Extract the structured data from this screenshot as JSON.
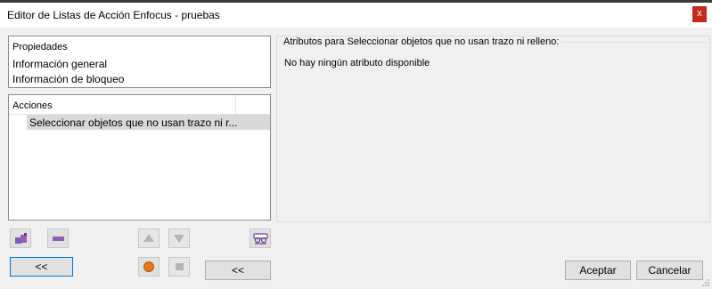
{
  "window": {
    "title": "Editor de Listas de Acción Enfocus - pruebas",
    "close_label": "x"
  },
  "properties": {
    "header": "Propiedades",
    "items": [
      "Información general",
      "Información de bloqueo"
    ]
  },
  "actions": {
    "header": "Acciones",
    "items": [
      "Seleccionar objetos que no usan trazo ni r..."
    ]
  },
  "attributes": {
    "title": "Atributos para Seleccionar objetos que no usan trazo ni relleno:",
    "empty_message": "No hay ningún atributo disponible"
  },
  "toolbar": {
    "icons": [
      "add-action-icon",
      "remove-action-icon",
      "move-up-icon",
      "move-down-icon",
      "preview-icon",
      "record-icon",
      "stop-icon"
    ]
  },
  "buttons": {
    "collapse_left": "<<",
    "collapse_middle": "<<",
    "accept": "Aceptar",
    "cancel": "Cancelar"
  },
  "colors": {
    "close_bg": "#c42b1c",
    "selection_bg": "#d9d9d9",
    "focus_border": "#0078d7",
    "record": "#e8761a"
  }
}
